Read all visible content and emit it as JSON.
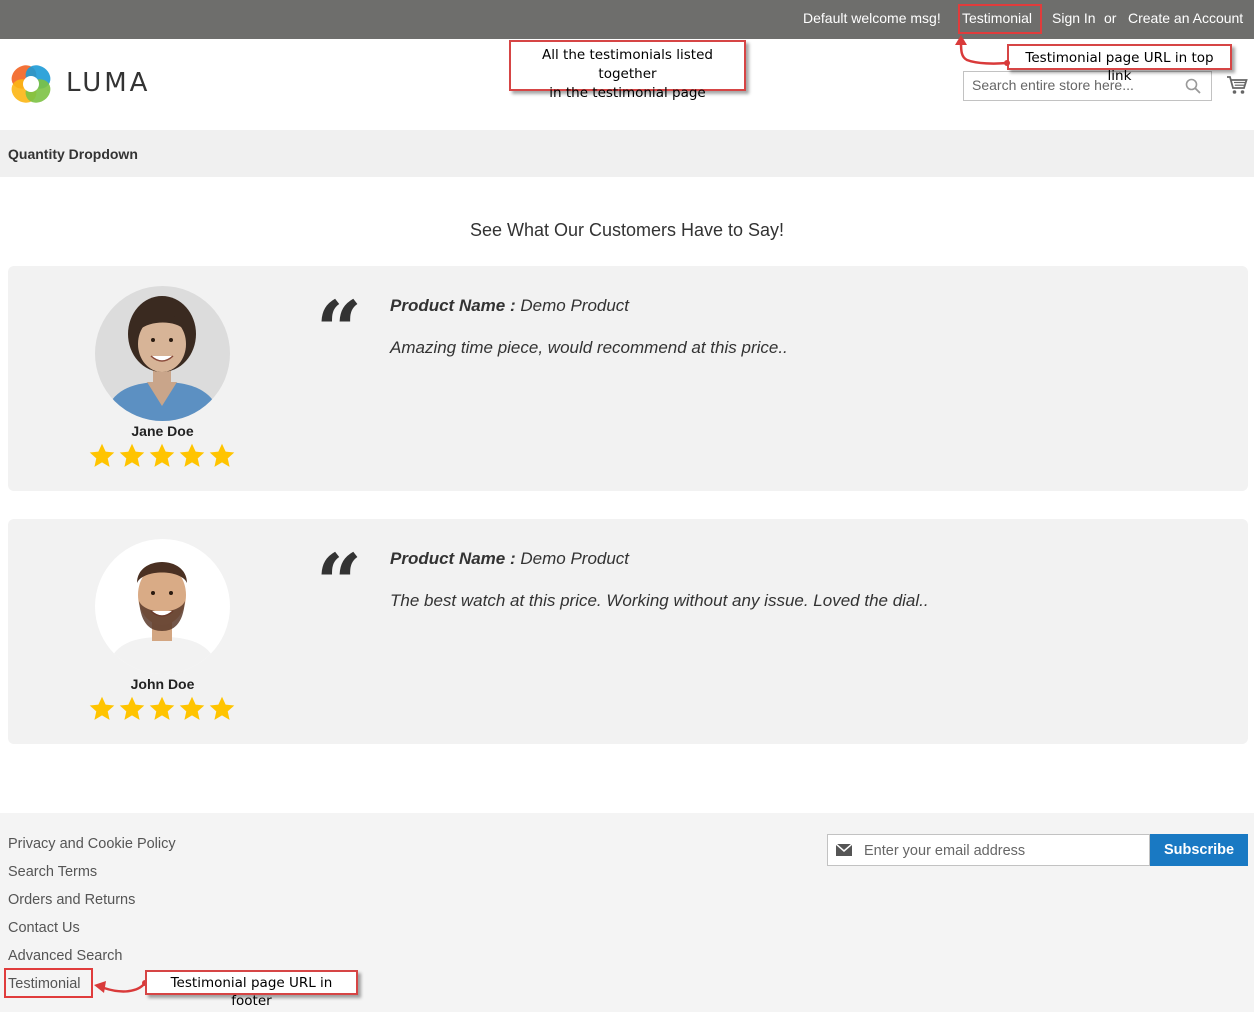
{
  "top_links": {
    "welcome": "Default welcome msg!",
    "testimonial": "Testimonial",
    "sign_in": "Sign In",
    "or": "or",
    "create_account": "Create an Account"
  },
  "header": {
    "logo_text": "LUMA",
    "search_placeholder": "Search entire store here..."
  },
  "annotations": {
    "page_callout_line1": "All the testimonials listed together",
    "page_callout_line2": "in the testimonial page",
    "top_link_callout": "Testimonial page URL in top link",
    "footer_callout": "Testimonial page URL in footer"
  },
  "breadcrumb": "Quantity Dropdown",
  "heading": "See What Our Customers Have to Say!",
  "testimonials": [
    {
      "name": "Jane Doe",
      "rating": 5,
      "product_label": "Product Name :",
      "product": "Demo Product",
      "text": "Amazing time piece, would recommend at this price.."
    },
    {
      "name": "John Doe",
      "rating": 5,
      "product_label": "Product Name :",
      "product": "Demo Product",
      "text": "The best watch at this price. Working without any issue. Loved the dial.."
    }
  ],
  "footer": {
    "links": [
      "Privacy and Cookie Policy",
      "Search Terms",
      "Orders and Returns",
      "Contact Us",
      "Advanced Search",
      "Testimonial"
    ],
    "newsletter_placeholder": "Enter your email address",
    "subscribe_label": "Subscribe"
  },
  "colors": {
    "top_bar": "#6e6e6c",
    "subscribe": "#1979c3",
    "highlight": "#e03c3c",
    "star": "#ffc400"
  }
}
